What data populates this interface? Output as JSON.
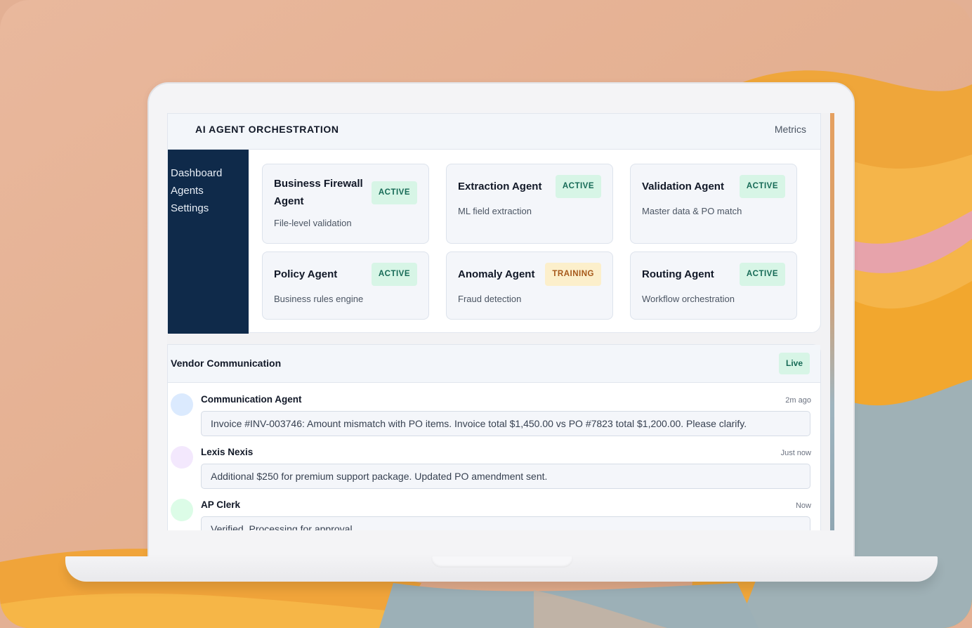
{
  "header": {
    "title": "AI AGENT ORCHESTRATION",
    "metrics_link": "Metrics"
  },
  "sidebar": {
    "items": [
      {
        "label": "Dashboard"
      },
      {
        "label": "Agents"
      },
      {
        "label": "Settings"
      }
    ]
  },
  "agents": [
    {
      "name": "Business Firewall Agent",
      "description": "File-level validation",
      "status": "ACTIVE"
    },
    {
      "name": "Extraction Agent",
      "description": "ML field extraction",
      "status": "ACTIVE"
    },
    {
      "name": "Validation Agent",
      "description": "Master data & PO match",
      "status": "ACTIVE"
    },
    {
      "name": "Policy Agent",
      "description": "Business rules engine",
      "status": "ACTIVE"
    },
    {
      "name": "Anomaly Agent",
      "description": "Fraud detection",
      "status": "TRAINING"
    },
    {
      "name": "Routing Agent",
      "description": "Workflow orchestration",
      "status": "ACTIVE"
    }
  ],
  "vendor": {
    "title": "Vendor Communication",
    "live_label": "Live",
    "messages": [
      {
        "sender": "Communication Agent",
        "time": "2m ago",
        "text": "Invoice #INV-003746: Amount mismatch with PO items. Invoice total $1,450.00 vs PO #7823 total $1,200.00. Please clarify.",
        "avatar_color": "#dbeafe"
      },
      {
        "sender": "Lexis Nexis",
        "time": "Just now",
        "text": "Additional $250 for premium support package. Updated PO amendment sent.",
        "avatar_color": "#f3e8fd"
      },
      {
        "sender": "AP Clerk",
        "time": "Now",
        "text": "Verified. Processing for approval.",
        "avatar_color": "#dcfce7"
      }
    ]
  },
  "colors": {
    "sidebar": "#0f2a4a",
    "active_badge_bg": "#d7f5e6",
    "active_badge_text": "#166a56",
    "training_badge_bg": "#fcefcb",
    "training_badge_text": "#a6581a"
  }
}
